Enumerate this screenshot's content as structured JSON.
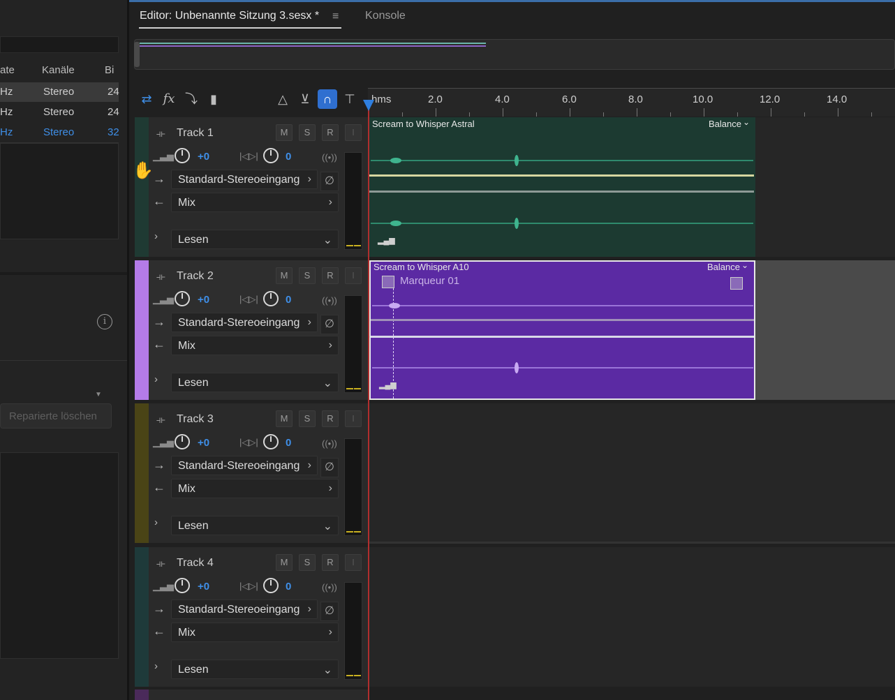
{
  "left_panel": {
    "headers": [
      "ate",
      "Kanäle",
      "Bi"
    ],
    "rows": [
      {
        "rate": "Hz",
        "channels": "Stereo",
        "bits": "24",
        "selected": false,
        "highlight": true
      },
      {
        "rate": "Hz",
        "channels": "Stereo",
        "bits": "24",
        "selected": false,
        "highlight": false
      },
      {
        "rate": "Hz",
        "channels": "Stereo",
        "bits": "32",
        "selected": true,
        "highlight": false
      }
    ],
    "button_label": "Reparierte löschen",
    "info_icon": "info-icon"
  },
  "editor": {
    "tab_editor": "Editor: Unbenannte Sitzung 3.sesx *",
    "tab_menu_icon": "≡",
    "tab_console": "Konsole"
  },
  "toolbar": {
    "icons": [
      "switch-arrows-icon",
      "fx-icon",
      "routing-icon",
      "meter-bars-icon",
      "metronome-icon",
      "punch-icon",
      "snap-magnet-icon",
      "marker-pin-icon"
    ]
  },
  "ruler": {
    "unit": "hms",
    "labels": [
      "2.0",
      "4.0",
      "6.0",
      "8.0",
      "10.0",
      "12.0",
      "14.0"
    ]
  },
  "tracks": [
    {
      "name": "Track 1",
      "color": "#1f3a33",
      "selected": false,
      "mute": "M",
      "solo": "S",
      "record": "R",
      "input": "I",
      "volume": "+0",
      "pan": "0",
      "input_label": "Standard-Stereoeingang",
      "output_label": "Mix",
      "automation_label": "Lesen"
    },
    {
      "name": "Track 2",
      "color": "#b47be8",
      "selected": true,
      "mute": "M",
      "solo": "S",
      "record": "R",
      "input": "I",
      "volume": "+0",
      "pan": "0",
      "input_label": "Standard-Stereoeingang",
      "output_label": "Mix",
      "automation_label": "Lesen"
    },
    {
      "name": "Track 3",
      "color": "#4a4416",
      "selected": false,
      "mute": "M",
      "solo": "S",
      "record": "R",
      "input": "I",
      "volume": "+0",
      "pan": "0",
      "input_label": "Standard-Stereoeingang",
      "output_label": "Mix",
      "automation_label": "Lesen"
    },
    {
      "name": "Track 4",
      "color": "#1e3a3a",
      "selected": false,
      "mute": "M",
      "solo": "S",
      "record": "R",
      "input": "I",
      "volume": "+0",
      "pan": "0",
      "input_label": "Standard-Stereoeingang",
      "output_label": "Mix",
      "automation_label": "Lesen"
    }
  ],
  "clips": [
    {
      "title": "Scream to Whisper Astral",
      "balance": "Balance",
      "track": 1,
      "color": "#1c3a31",
      "wave_color": "#3fb48e"
    },
    {
      "title": "Scream to Whisper A10",
      "balance": "Balance",
      "track": 2,
      "color": "#5b2aa3",
      "wave_color": "#b792ee",
      "marker": "Marqueur 01"
    }
  ],
  "colors": {
    "accent_blue": "#3f8fe8",
    "playhead": "#2f7fe0",
    "playhead_line": "#b02e2e"
  }
}
